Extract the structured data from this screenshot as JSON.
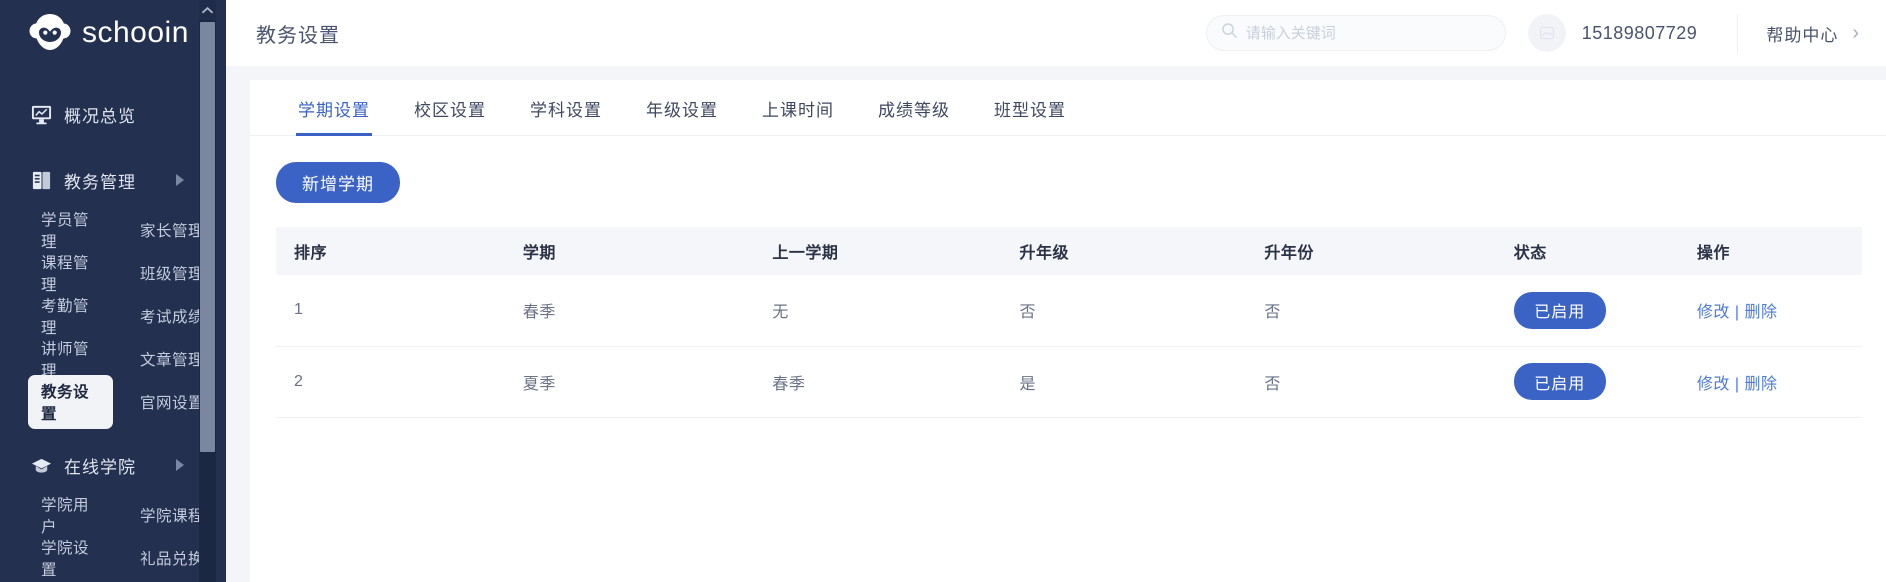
{
  "brand": {
    "name": "schooin",
    "logo_icon": "monkey-face-logo"
  },
  "sidebar": {
    "overview": {
      "label": "概况总览",
      "icon": "monitor-chart-icon"
    },
    "groups": [
      {
        "label": "教务管理",
        "icon": "book-icon",
        "arrow_icon": "triangle-right-icon",
        "items": [
          {
            "label": "学员管理",
            "active": false
          },
          {
            "label": "家长管理",
            "active": false
          },
          {
            "label": "课程管理",
            "active": false
          },
          {
            "label": "班级管理",
            "active": false
          },
          {
            "label": "考勤管理",
            "active": false
          },
          {
            "label": "考试成绩",
            "active": false
          },
          {
            "label": "讲师管理",
            "active": false
          },
          {
            "label": "文章管理",
            "active": false
          },
          {
            "label": "教务设置",
            "active": true
          },
          {
            "label": "官网设置",
            "active": false
          }
        ]
      },
      {
        "label": "在线学院",
        "icon": "graduation-cap-icon",
        "arrow_icon": "triangle-right-icon",
        "items": [
          {
            "label": "学院用户",
            "active": false
          },
          {
            "label": "学院课程",
            "active": false
          },
          {
            "label": "学院设置",
            "active": false
          },
          {
            "label": "礼品兑换",
            "active": false
          }
        ]
      }
    ],
    "scrollbar": {
      "up_icon": "chevron-up-icon"
    }
  },
  "header": {
    "title": "教务设置",
    "search": {
      "placeholder": "请输入关键词",
      "value": "",
      "icon": "search-icon"
    },
    "avatar_icon": "user-avatar-placeholder",
    "phone": "15189807729",
    "help": {
      "label": "帮助中心",
      "chevron": "›"
    }
  },
  "tabs": [
    {
      "label": "学期设置",
      "active": true
    },
    {
      "label": "校区设置",
      "active": false
    },
    {
      "label": "学科设置",
      "active": false
    },
    {
      "label": "年级设置",
      "active": false
    },
    {
      "label": "上课时间",
      "active": false
    },
    {
      "label": "成绩等级",
      "active": false
    },
    {
      "label": "班型设置",
      "active": false
    }
  ],
  "toolbar": {
    "add_label": "新增学期"
  },
  "table": {
    "columns": [
      "排序",
      "学期",
      "上一学期",
      "升年级",
      "升年份",
      "状态",
      "操作"
    ],
    "rows": [
      {
        "sort": "1",
        "term": "春季",
        "prev_term": "无",
        "upgrade_grade": "否",
        "upgrade_year": "否",
        "status": "已启用",
        "ops": {
          "edit": "修改",
          "sep": "|",
          "delete": "删除"
        }
      },
      {
        "sort": "2",
        "term": "夏季",
        "prev_term": "春季",
        "upgrade_grade": "是",
        "upgrade_year": "否",
        "status": "已启用",
        "ops": {
          "edit": "修改",
          "sep": "|",
          "delete": "删除"
        }
      }
    ]
  },
  "colors": {
    "sidebar_bg": "#23304f",
    "accent": "#3b63c6",
    "link": "#4d7bd6",
    "content_bg": "#f4f5f9",
    "table_head_bg": "#f4f6fa"
  }
}
